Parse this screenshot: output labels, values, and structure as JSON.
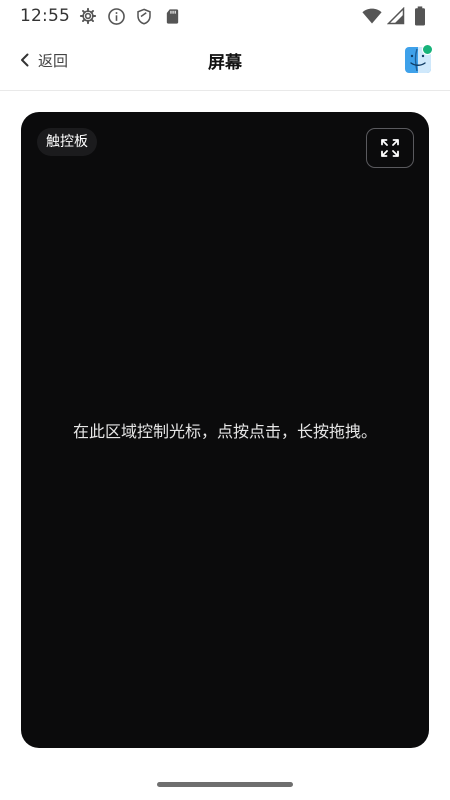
{
  "status_bar": {
    "time": "12:55",
    "left_icons": [
      "gear-icon",
      "info-icon",
      "shield-icon",
      "sd-card-icon"
    ],
    "right_icons": [
      "wifi-icon",
      "signal-icon",
      "battery-icon"
    ]
  },
  "header": {
    "back_label": "返回",
    "title": "屏幕",
    "app_icon": "finder-icon",
    "status_dot_color": "#18b37a"
  },
  "touchpad": {
    "label": "触控板",
    "hint": "在此区域控制光标，点按点击，长按拖拽。",
    "fullscreen_icon": "expand-icon"
  }
}
